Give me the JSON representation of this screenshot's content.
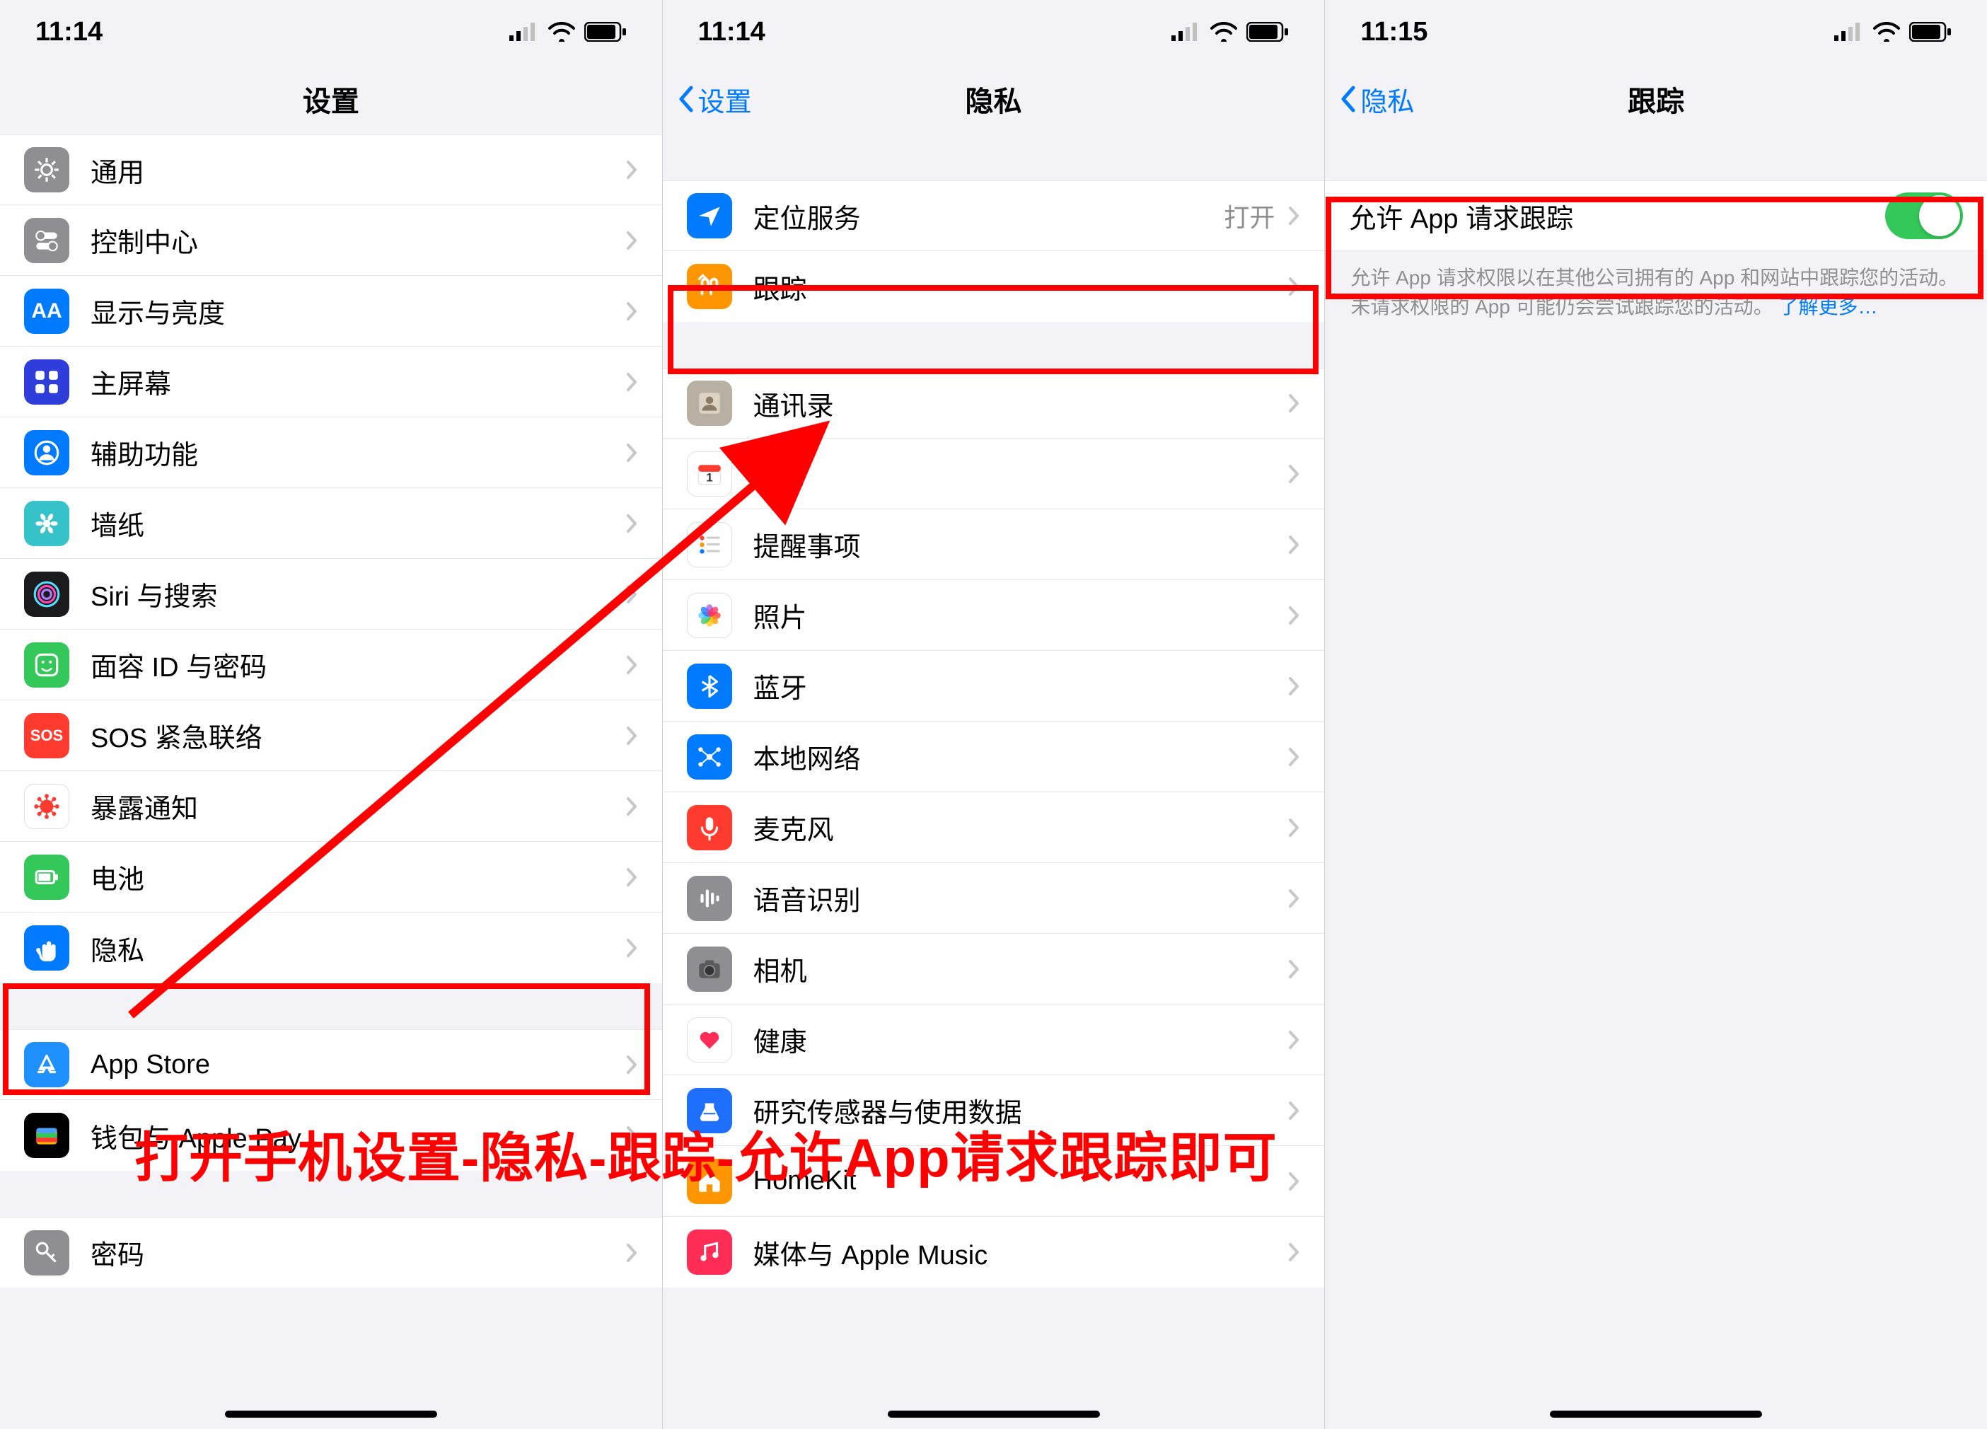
{
  "overlay_instruction": "打开手机设置-隐私-跟踪-允许App请求跟踪即可",
  "phone1": {
    "time": "11:14",
    "nav_title": "设置",
    "items": [
      {
        "label": "通用",
        "icon": "gear",
        "bg": "#8e8e93"
      },
      {
        "label": "控制中心",
        "icon": "switches",
        "bg": "#8e8e93"
      },
      {
        "label": "显示与亮度",
        "icon": "AA",
        "bg": "#007aff"
      },
      {
        "label": "主屏幕",
        "icon": "grid",
        "bg": "#2f3edb"
      },
      {
        "label": "辅助功能",
        "icon": "person",
        "bg": "#007aff"
      },
      {
        "label": "墙纸",
        "icon": "flower",
        "bg": "#35c2c8"
      },
      {
        "label": "Siri 与搜索",
        "icon": "siri",
        "bg": "#1b1b1d"
      },
      {
        "label": "面容 ID 与密码",
        "icon": "faceid",
        "bg": "#34c759"
      },
      {
        "label": "SOS 紧急联络",
        "icon": "SOS",
        "bg": "#ff3b30"
      },
      {
        "label": "暴露通知",
        "icon": "virus",
        "bg": "#ffffff",
        "fg": "#ff3b30"
      },
      {
        "label": "电池",
        "icon": "battery",
        "bg": "#34c759"
      },
      {
        "label": "隐私",
        "icon": "hand",
        "bg": "#007aff"
      }
    ],
    "group2": [
      {
        "label": "App Store",
        "icon": "appstore",
        "bg": "#1e90ff"
      },
      {
        "label": "钱包与 Apple Pay",
        "icon": "wallet",
        "bg": "#000000"
      }
    ],
    "group3": [
      {
        "label": "密码",
        "icon": "key",
        "bg": "#8e8e93"
      }
    ]
  },
  "phone2": {
    "time": "11:14",
    "back": "设置",
    "nav_title": "隐私",
    "group1": [
      {
        "label": "定位服务",
        "icon": "location",
        "bg": "#007aff",
        "value": "打开"
      },
      {
        "label": "跟踪",
        "icon": "tracking",
        "bg": "#ff9500"
      }
    ],
    "group2": [
      {
        "label": "通讯录",
        "icon": "contacts",
        "bg": "#b9b0a4"
      },
      {
        "label": "日历",
        "icon": "calendar",
        "bg": "#ffffff",
        "fg": "#ff3b30"
      },
      {
        "label": "提醒事项",
        "icon": "reminders",
        "bg": "#ffffff"
      },
      {
        "label": "照片",
        "icon": "photos",
        "bg": "#ffffff"
      },
      {
        "label": "蓝牙",
        "icon": "bluetooth",
        "bg": "#007aff"
      },
      {
        "label": "本地网络",
        "icon": "network",
        "bg": "#007aff"
      },
      {
        "label": "麦克风",
        "icon": "mic",
        "bg": "#ff3b30"
      },
      {
        "label": "语音识别",
        "icon": "speech",
        "bg": "#8e8e93"
      },
      {
        "label": "相机",
        "icon": "camera",
        "bg": "#8e8e93"
      },
      {
        "label": "健康",
        "icon": "health",
        "bg": "#ffffff",
        "fg": "#ff2d55"
      },
      {
        "label": "研究传感器与使用数据",
        "icon": "research",
        "bg": "#1f6fff"
      },
      {
        "label": "HomeKit",
        "icon": "home",
        "bg": "#ff9500"
      },
      {
        "label": "媒体与 Apple Music",
        "icon": "music",
        "bg": "#ff2d55"
      }
    ]
  },
  "phone3": {
    "time": "11:15",
    "back": "隐私",
    "nav_title": "跟踪",
    "toggle_label": "允许 App 请求跟踪",
    "footer": "允许 App 请求权限以在其他公司拥有的 App 和网站中跟踪您的活动。未请求权限的 App 可能仍会尝试跟踪您的活动。",
    "learn_more": "了解更多…"
  }
}
